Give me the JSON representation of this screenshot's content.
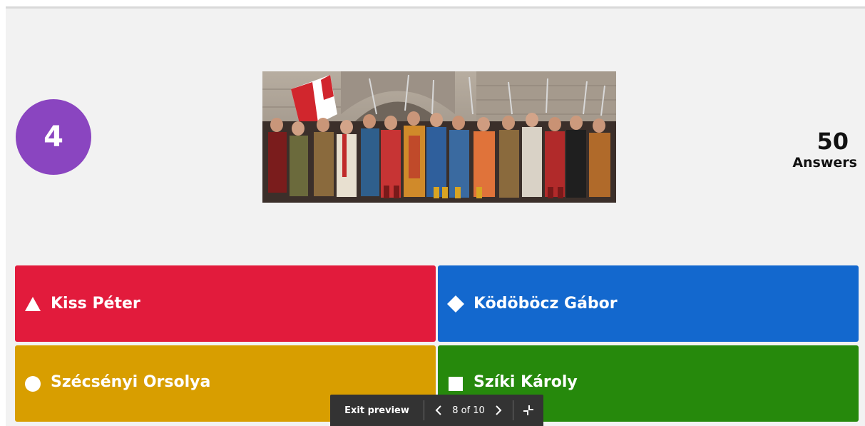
{
  "question": {
    "timer": "4",
    "answers_count": "50",
    "answers_label": "Answers",
    "image_icon": "medieval-soldiers-photo"
  },
  "answers": [
    {
      "label": "Kiss Péter",
      "shape": "triangle-icon",
      "color": "#e21b3c"
    },
    {
      "label": "Ködöböcz Gábor",
      "shape": "diamond-icon",
      "color": "#1368ce"
    },
    {
      "label": "Szécsényi Orsolya",
      "shape": "circle-icon",
      "color": "#d89e00"
    },
    {
      "label": "Szíki Károly",
      "shape": "square-icon",
      "color": "#26890c"
    }
  ],
  "preview_bar": {
    "exit_label": "Exit preview",
    "counter": "8 of 10"
  },
  "colors": {
    "timer": "#8a45c0",
    "stage": "#f2f2f2",
    "preview_bar": "#333333"
  }
}
